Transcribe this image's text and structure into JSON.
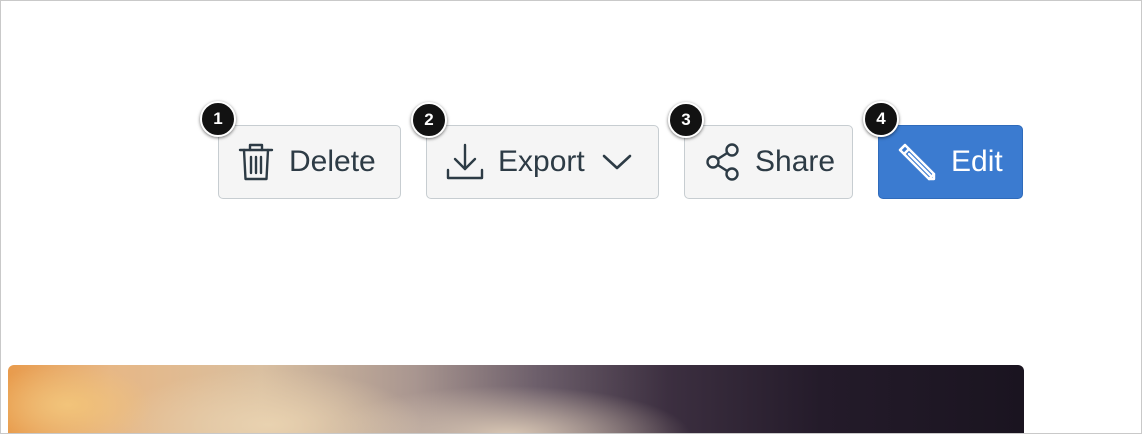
{
  "toolbar": {
    "delete": {
      "label": "Delete",
      "icon": "trash-icon",
      "badge": "1"
    },
    "export": {
      "label": "Export",
      "icon": "download-icon",
      "dropdown_icon": "chevron-down-icon",
      "badge": "2"
    },
    "share": {
      "label": "Share",
      "icon": "share-icon",
      "badge": "3"
    },
    "edit": {
      "label": "Edit",
      "icon": "pencil-icon",
      "badge": "4"
    }
  },
  "colors": {
    "primary_button": "#3b7bd0",
    "secondary_button": "#f5f5f5",
    "text": "#2d3b45",
    "badge": "#121212"
  },
  "content": {
    "image": "decorative-photo"
  }
}
